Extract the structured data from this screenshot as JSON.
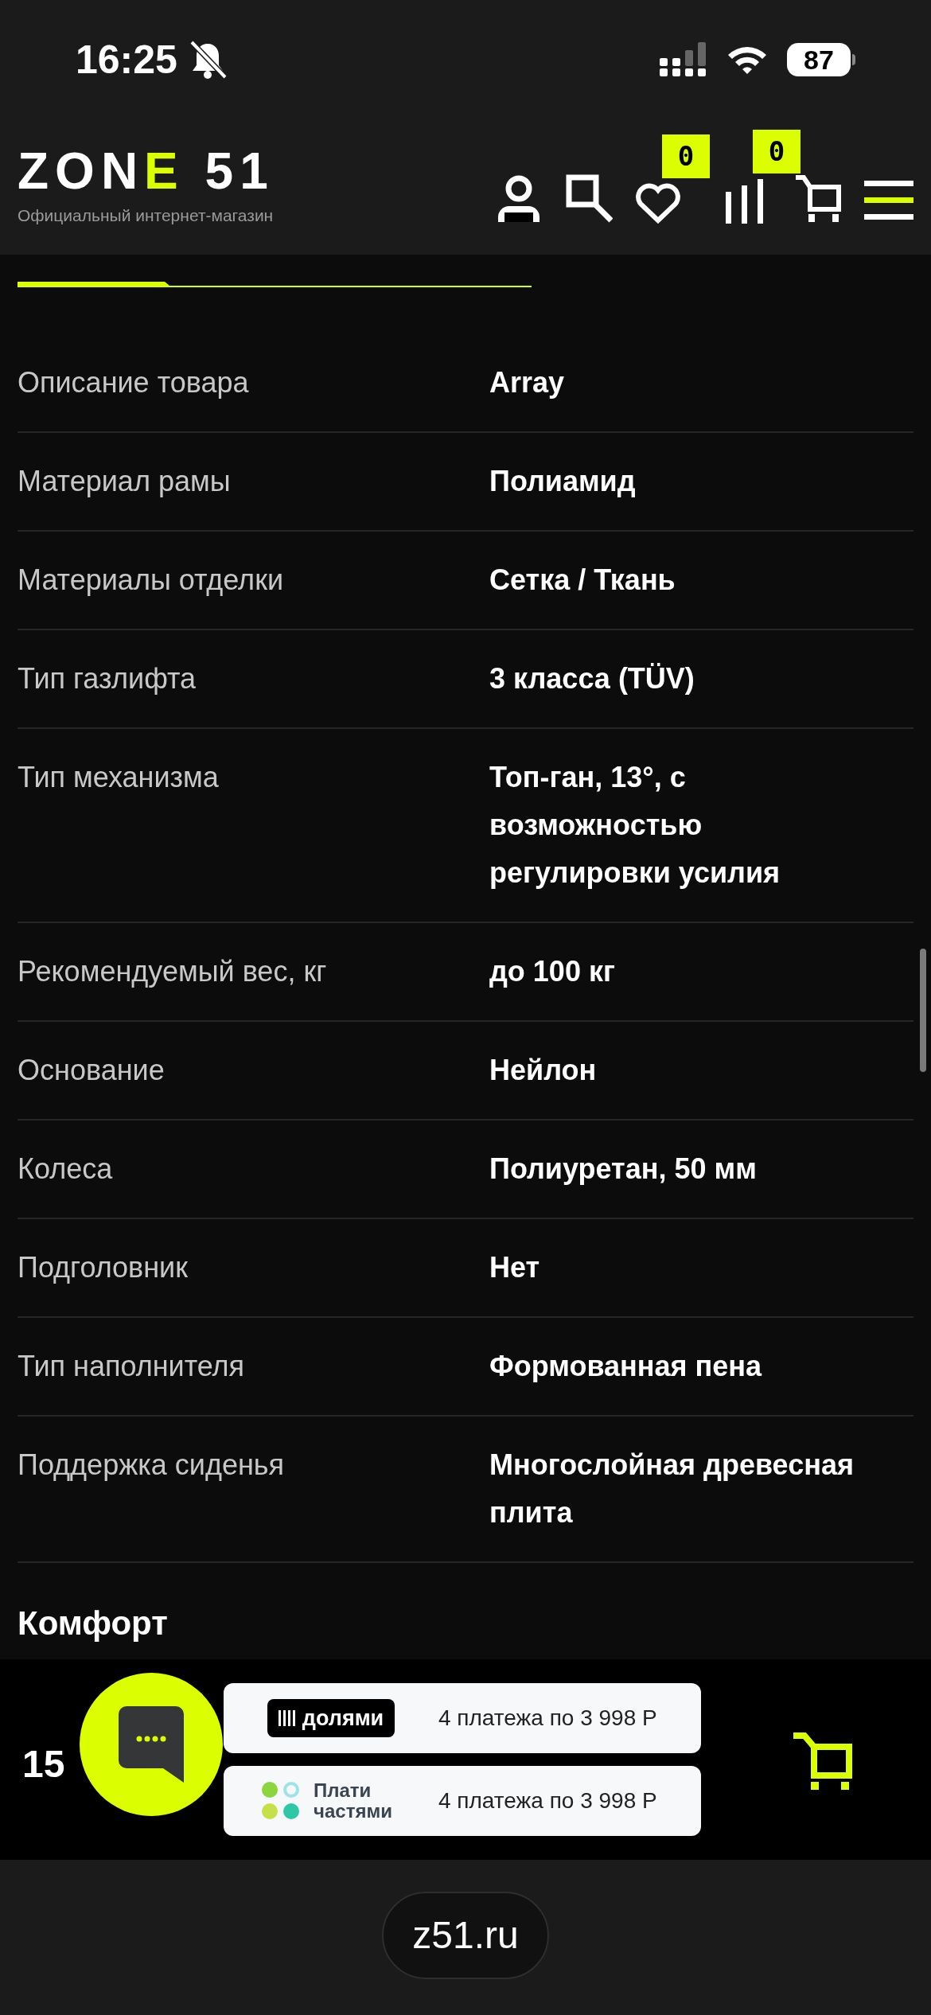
{
  "status_bar": {
    "time": "16:25",
    "battery": "87"
  },
  "header": {
    "logo": {
      "before": "ZON",
      "accent": "E",
      "after": " 51"
    },
    "tagline": "Официальный интернет-магазин",
    "badges": {
      "favorites": "0",
      "compare": "0"
    }
  },
  "specs": [
    {
      "label": "Описание товара",
      "value": "Array"
    },
    {
      "label": "Материал рамы",
      "value": "Полиамид"
    },
    {
      "label": "Материалы отделки",
      "value": "Сетка / Ткань"
    },
    {
      "label": "Тип газлифта",
      "value": "3 класса (TÜV)"
    },
    {
      "label": "Тип механизма",
      "value": "Топ-ган, 13°, с возможностью регулировки усилия"
    },
    {
      "label": "Рекомендуемый вес, кг",
      "value": "до 100 кг"
    },
    {
      "label": "Основание",
      "value": "Нейлон"
    },
    {
      "label": "Колеса",
      "value": "Полиуретан, 50 мм"
    },
    {
      "label": "Подголовник",
      "value": "Нет"
    },
    {
      "label": "Тип наполнителя",
      "value": "Формованная пена"
    },
    {
      "label": "Поддержка сиденья",
      "value": "Многослойная древесная плита"
    }
  ],
  "section_title": "Комфорт",
  "buy_bar": {
    "price": "15",
    "payments": [
      {
        "kind": "dolyami",
        "logo": "долями",
        "text": "4 платежа по 3 998 Р"
      },
      {
        "kind": "plati",
        "logo": "Плати частями",
        "text": "4 платежа по 3 998 Р"
      }
    ]
  },
  "browser": {
    "url": "z51.ru"
  }
}
